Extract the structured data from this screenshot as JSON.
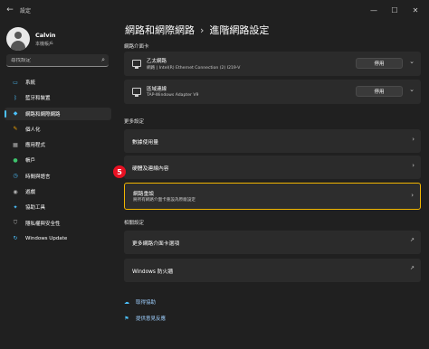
{
  "window": {
    "app_title": "設定",
    "controls": {
      "minimize": "—",
      "maximize": "☐",
      "close": "✕"
    }
  },
  "profile": {
    "name": "Calvin",
    "account": "本機帳戶"
  },
  "search": {
    "placeholder": "尋找設定"
  },
  "sidebar": {
    "items": [
      {
        "label": "系統",
        "icon": "monitor-icon",
        "color": "#4cc2ff"
      },
      {
        "label": "藍牙和裝置",
        "icon": "bluetooth-icon",
        "color": "#4cc2ff"
      },
      {
        "label": "網路和網際網路",
        "icon": "wifi-icon",
        "color": "#4cc2ff",
        "active": true
      },
      {
        "label": "個人化",
        "icon": "brush-icon",
        "color": "#f7a600"
      },
      {
        "label": "應用程式",
        "icon": "apps-icon",
        "color": "#b4b4b4"
      },
      {
        "label": "帳戶",
        "icon": "person-icon",
        "color": "#3ec46d"
      },
      {
        "label": "時間與語言",
        "icon": "globe-clock-icon",
        "color": "#4cc2ff"
      },
      {
        "label": "遊戲",
        "icon": "gamepad-icon",
        "color": "#b4b4b4"
      },
      {
        "label": "協助工具",
        "icon": "accessibility-icon",
        "color": "#4cc2ff"
      },
      {
        "label": "隱私權與安全性",
        "icon": "shield-icon",
        "color": "#b4b4b4"
      },
      {
        "label": "Windows Update",
        "icon": "update-icon",
        "color": "#4cc2ff"
      }
    ]
  },
  "breadcrumb": {
    "parent": "網路和網際網路",
    "separator": "›",
    "current": "進階網路設定"
  },
  "sections": {
    "adapters": "網路介面卡",
    "more": "更多設定",
    "related": "相關設定"
  },
  "adapters": [
    {
      "name": "乙太網路",
      "desc": "網路 | Intel(R) Ethernet Connection (2) I219-V",
      "button": "停用"
    },
    {
      "name": "區域連線",
      "desc": "TAP-Windows Adapter V9",
      "button": "停用"
    }
  ],
  "more_settings": [
    {
      "title": "數據使用量"
    },
    {
      "title": "硬體及連線內容"
    },
    {
      "title": "網路重設",
      "desc": "將所有網路介面卡重設為原廠設定"
    }
  ],
  "related_settings": [
    {
      "title": "更多網路介面卡選項"
    },
    {
      "title": "Windows 防火牆"
    }
  ],
  "callout_number": "5",
  "footer_links": [
    {
      "label": "取得協助",
      "icon": "help-icon"
    },
    {
      "label": "提供意見反應",
      "icon": "feedback-icon"
    }
  ],
  "colors": {
    "accent": "#4cc2ff",
    "highlight_border": "#f2b600",
    "callout": "#e81123"
  }
}
